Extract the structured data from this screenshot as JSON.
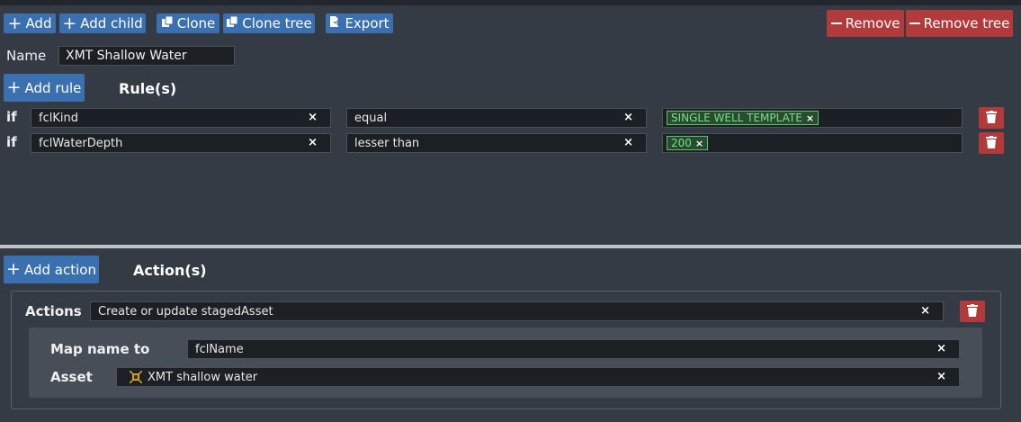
{
  "toolbar": {
    "add_label": "Add",
    "add_child_label": "Add child",
    "clone_label": "Clone",
    "clone_tree_label": "Clone tree",
    "export_label": "Export",
    "remove_label": "Remove",
    "remove_tree_label": "Remove tree"
  },
  "name": {
    "label": "Name",
    "value": "XMT Shallow Water"
  },
  "rules": {
    "add_rule_label": "Add rule",
    "heading": "Rule(s)",
    "items": [
      {
        "prefix": "if",
        "field": "fclKind",
        "operator": "equal",
        "value_tag": "SINGLE WELL TEMPLATE"
      },
      {
        "prefix": "if",
        "field": "fclWaterDepth",
        "operator": "lesser than",
        "value_tag": "200"
      }
    ]
  },
  "actions": {
    "add_action_label": "Add action",
    "heading": "Action(s)",
    "actions_label": "Actions",
    "actions_value": "Create or update stagedAsset",
    "map_name_label": "Map name to",
    "map_name_value": "fclName",
    "asset_label": "Asset",
    "asset_value": "XMT shallow water"
  },
  "colors": {
    "background": "#353b44",
    "primary": "#3a6fb0",
    "danger": "#b23a3a",
    "tag_green": "#5fbf6b",
    "field_bg": "#1c1f23"
  },
  "icons": {
    "clear": "×",
    "plus": "+"
  }
}
